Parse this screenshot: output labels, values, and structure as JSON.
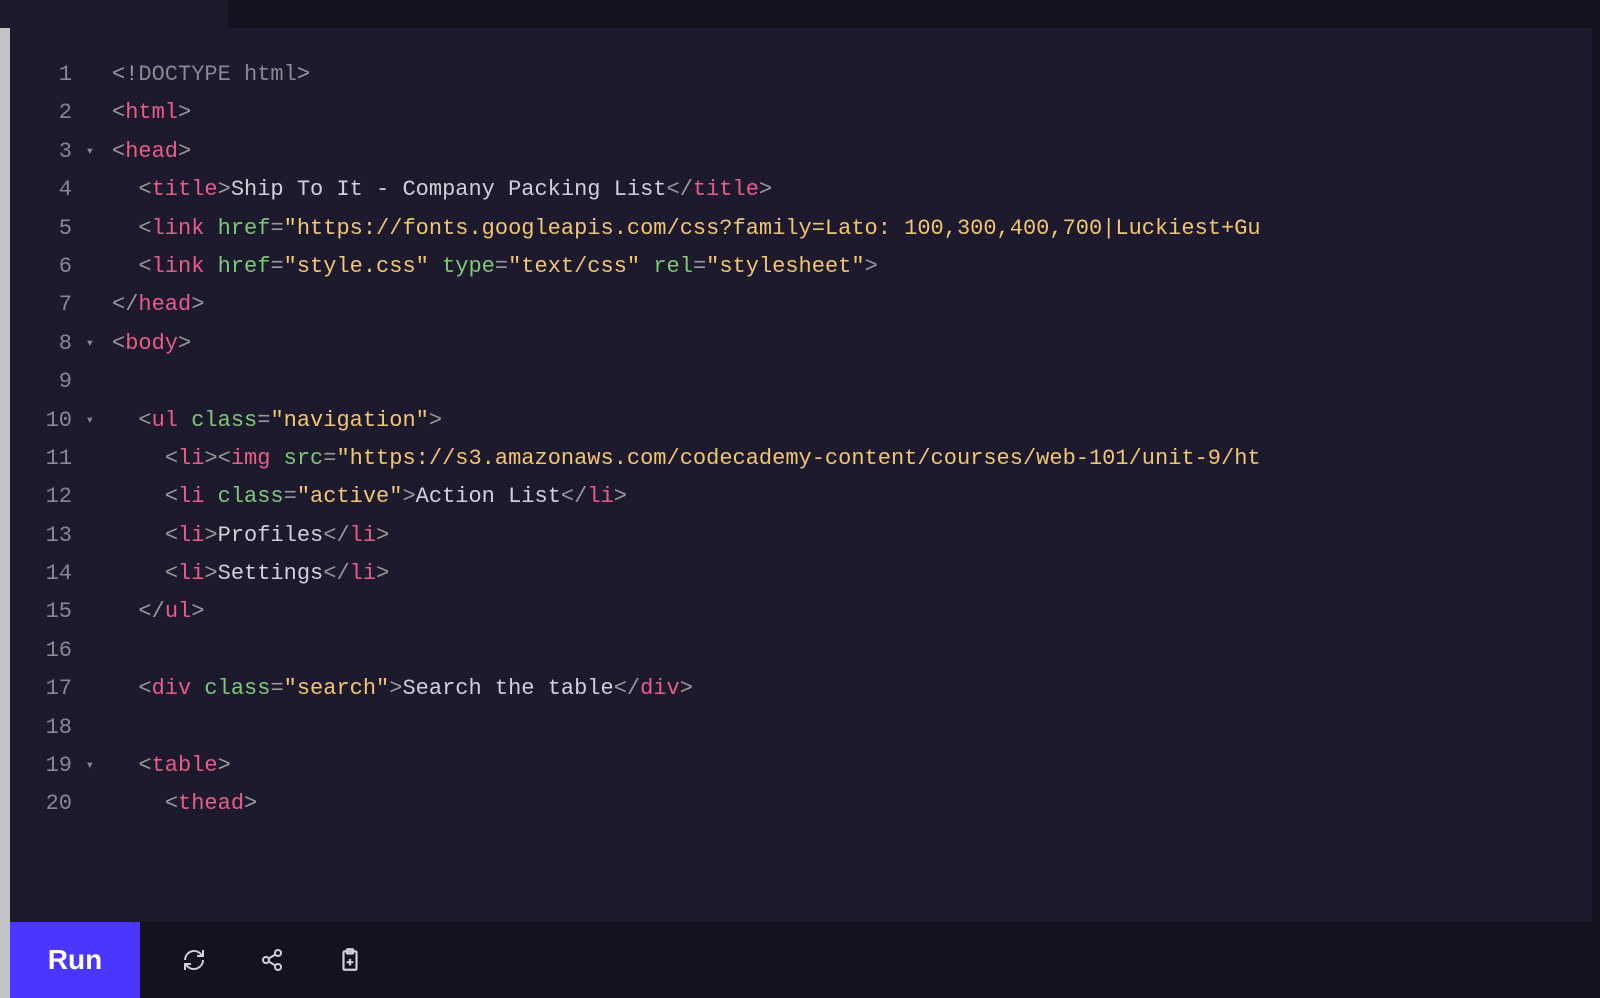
{
  "toolbar": {
    "run_label": "Run"
  },
  "lines": [
    {
      "num": "1",
      "fold": "",
      "html": "<span class='tag-bracket'>&lt;!</span><span class='doctype'>DOCTYPE html</span><span class='tag-bracket'>&gt;</span>"
    },
    {
      "num": "2",
      "fold": "",
      "html": "<span class='tag-bracket'>&lt;</span><span class='tag-name'>html</span><span class='tag-bracket'>&gt;</span>"
    },
    {
      "num": "3",
      "fold": "▾",
      "html": "<span class='tag-bracket'>&lt;</span><span class='tag-name'>head</span><span class='tag-bracket'>&gt;</span>"
    },
    {
      "num": "4",
      "fold": "",
      "html": "  <span class='tag-bracket'>&lt;</span><span class='tag-name'>title</span><span class='tag-bracket'>&gt;</span><span class='text-content'>Ship To It - Company Packing List</span><span class='tag-bracket'>&lt;/</span><span class='tag-name'>title</span><span class='tag-bracket'>&gt;</span>"
    },
    {
      "num": "5",
      "fold": "",
      "html": "  <span class='tag-bracket'>&lt;</span><span class='tag-name'>link</span> <span class='attr-name'>href</span><span class='tag-bracket'>=</span><span class='attr-value'>\"https://fonts.googleapis.com/css?family=Lato: 100,300,400,700|Luckiest+Gu</span>"
    },
    {
      "num": "6",
      "fold": "",
      "html": "  <span class='tag-bracket'>&lt;</span><span class='tag-name'>link</span> <span class='attr-name'>href</span><span class='tag-bracket'>=</span><span class='attr-value'>\"style.css\"</span> <span class='attr-name'>type</span><span class='tag-bracket'>=</span><span class='attr-value'>\"text/css\"</span> <span class='attr-name'>rel</span><span class='tag-bracket'>=</span><span class='attr-value'>\"stylesheet\"</span><span class='tag-bracket'>&gt;</span>"
    },
    {
      "num": "7",
      "fold": "",
      "html": "<span class='tag-bracket'>&lt;/</span><span class='tag-name'>head</span><span class='tag-bracket'>&gt;</span>"
    },
    {
      "num": "8",
      "fold": "▾",
      "html": "<span class='tag-bracket'>&lt;</span><span class='tag-name'>body</span><span class='tag-bracket'>&gt;</span>"
    },
    {
      "num": "9",
      "fold": "",
      "html": ""
    },
    {
      "num": "10",
      "fold": "▾",
      "html": "  <span class='tag-bracket'>&lt;</span><span class='tag-name'>ul</span> <span class='attr-name'>class</span><span class='tag-bracket'>=</span><span class='attr-value'>\"navigation\"</span><span class='tag-bracket'>&gt;</span>"
    },
    {
      "num": "11",
      "fold": "",
      "html": "    <span class='tag-bracket'>&lt;</span><span class='tag-name'>li</span><span class='tag-bracket'>&gt;&lt;</span><span class='tag-name'>img</span> <span class='attr-name'>src</span><span class='tag-bracket'>=</span><span class='attr-value'>\"https://s3.amazonaws.com/codecademy-content/courses/web-101/unit-9/ht</span>"
    },
    {
      "num": "12",
      "fold": "",
      "html": "    <span class='tag-bracket'>&lt;</span><span class='tag-name'>li</span> <span class='attr-name'>class</span><span class='tag-bracket'>=</span><span class='attr-value'>\"active\"</span><span class='tag-bracket'>&gt;</span><span class='text-content'>Action List</span><span class='tag-bracket'>&lt;/</span><span class='tag-name'>li</span><span class='tag-bracket'>&gt;</span>"
    },
    {
      "num": "13",
      "fold": "",
      "html": "    <span class='tag-bracket'>&lt;</span><span class='tag-name'>li</span><span class='tag-bracket'>&gt;</span><span class='text-content'>Profiles</span><span class='tag-bracket'>&lt;/</span><span class='tag-name'>li</span><span class='tag-bracket'>&gt;</span>"
    },
    {
      "num": "14",
      "fold": "",
      "html": "    <span class='tag-bracket'>&lt;</span><span class='tag-name'>li</span><span class='tag-bracket'>&gt;</span><span class='text-content'>Settings</span><span class='tag-bracket'>&lt;/</span><span class='tag-name'>li</span><span class='tag-bracket'>&gt;</span>"
    },
    {
      "num": "15",
      "fold": "",
      "html": "  <span class='tag-bracket'>&lt;/</span><span class='tag-name'>ul</span><span class='tag-bracket'>&gt;</span>"
    },
    {
      "num": "16",
      "fold": "",
      "html": ""
    },
    {
      "num": "17",
      "fold": "",
      "html": "  <span class='tag-bracket'>&lt;</span><span class='tag-name'>div</span> <span class='attr-name'>class</span><span class='tag-bracket'>=</span><span class='attr-value'>\"search\"</span><span class='tag-bracket'>&gt;</span><span class='text-content'>Search the table</span><span class='tag-bracket'>&lt;/</span><span class='tag-name'>div</span><span class='tag-bracket'>&gt;</span>"
    },
    {
      "num": "18",
      "fold": "",
      "html": ""
    },
    {
      "num": "19",
      "fold": "▾",
      "html": "  <span class='tag-bracket'>&lt;</span><span class='tag-name'>table</span><span class='tag-bracket'>&gt;</span>"
    },
    {
      "num": "20",
      "fold": "",
      "html": "    <span class='tag-bracket'>&lt;</span><span class='tag-name'>thead</span><span class='tag-bracket'>&gt;</span>"
    }
  ]
}
